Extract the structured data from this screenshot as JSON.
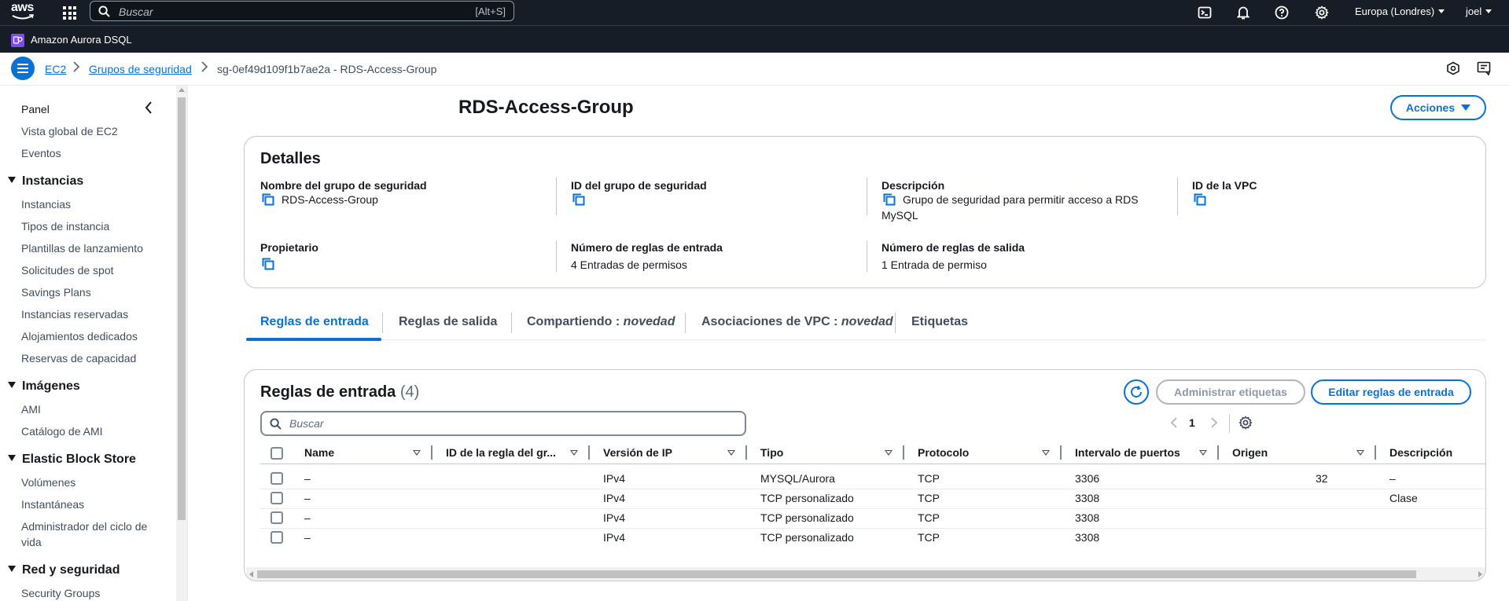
{
  "topnav": {
    "logo_text": "aws",
    "search_placeholder": "Buscar",
    "search_shortcut": "[Alt+S]",
    "region": "Europa (Londres)",
    "user": "joel",
    "icons": [
      "cloudshell-icon",
      "bell-icon",
      "help-icon",
      "gear-icon"
    ]
  },
  "service_bar": {
    "label": "Amazon Aurora DSQL"
  },
  "breadcrumb": {
    "items": [
      "EC2",
      "Grupos de seguridad",
      "sg-0ef49d109f1b7ae2a - RDS-Access-Group"
    ]
  },
  "sidebar": {
    "panel_label": "Panel",
    "top_items": [
      "Vista global de EC2",
      "Eventos"
    ],
    "sections": [
      {
        "title": "Instancias",
        "items": [
          "Instancias",
          "Tipos de instancia",
          "Plantillas de lanzamiento",
          "Solicitudes de spot",
          "Savings Plans",
          "Instancias reservadas",
          "Alojamientos dedicados",
          "Reservas de capacidad"
        ]
      },
      {
        "title": "Imágenes",
        "items": [
          "AMI",
          "Catálogo de AMI"
        ]
      },
      {
        "title": "Elastic Block Store",
        "items": [
          "Volúmenes",
          "Instantáneas",
          "Administrador del ciclo de",
          "vida"
        ]
      },
      {
        "title": "Red y seguridad",
        "items": [
          "Security Groups"
        ]
      }
    ]
  },
  "page": {
    "title": "RDS-Access-Group",
    "actions_label": "Acciones"
  },
  "details": {
    "heading": "Detalles",
    "fields": {
      "sg_name_label": "Nombre del grupo de seguridad",
      "sg_name_value": "RDS-Access-Group",
      "sg_id_label": "ID del grupo de seguridad",
      "description_label": "Descripción",
      "description_value_1": "Grupo de seguridad para permitir acceso a RDS",
      "description_value_2": "MySQL",
      "vpc_id_label": "ID de la VPC",
      "owner_label": "Propietario",
      "inbound_count_label": "Número de reglas de entrada",
      "inbound_count_value": "4 Entradas de permisos",
      "outbound_count_label": "Número de reglas de salida",
      "outbound_count_value": "1 Entrada de permiso"
    }
  },
  "tabs": [
    {
      "label": "Reglas de entrada",
      "suffix": ""
    },
    {
      "label": "Reglas de salida",
      "suffix": ""
    },
    {
      "label": "Compartiendo : ",
      "suffix": "novedad"
    },
    {
      "label": "Asociaciones de VPC : ",
      "suffix": "novedad"
    },
    {
      "label": "Etiquetas",
      "suffix": ""
    }
  ],
  "rules": {
    "title": "Reglas de entrada",
    "count": "(4)",
    "manage_tags_label": "Administrar etiquetas",
    "edit_label": "Editar reglas de entrada",
    "filter_placeholder": "Buscar",
    "page_number": "1",
    "columns": [
      "Name",
      "ID de la regla del gr...",
      "Versión de IP",
      "Tipo",
      "Protocolo",
      "Intervalo de puertos",
      "Origen",
      "Descripción"
    ],
    "rows": [
      {
        "name": "–",
        "rule_id": "",
        "ip": "IPv4",
        "type": "MYSQL/Aurora",
        "protocol": "TCP",
        "ports": "3306",
        "source": "32",
        "description": "–"
      },
      {
        "name": "–",
        "rule_id": "",
        "ip": "IPv4",
        "type": "TCP personalizado",
        "protocol": "TCP",
        "ports": "3308",
        "source": "",
        "description": "Clase"
      },
      {
        "name": "–",
        "rule_id": "",
        "ip": "IPv4",
        "type": "TCP personalizado",
        "protocol": "TCP",
        "ports": "3308",
        "source": "",
        "description": ""
      },
      {
        "name": "–",
        "rule_id": "",
        "ip": "IPv4",
        "type": "TCP personalizado",
        "protocol": "TCP",
        "ports": "3308",
        "source": "",
        "description": ""
      }
    ]
  },
  "colors": {
    "nav_bg": "#161d26",
    "accent": "#0972d3",
    "text": "#16191f",
    "service_icon": "#7d4ee6"
  }
}
